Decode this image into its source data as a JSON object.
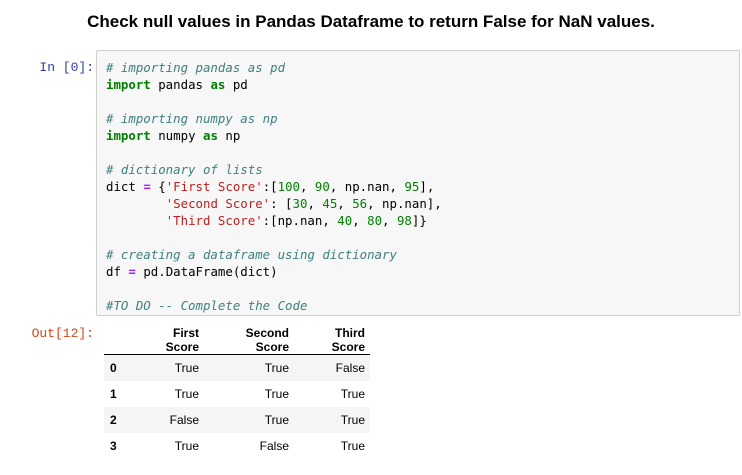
{
  "title": "Check null values in Pandas Dataframe to return False for NaN values.",
  "input_prompt": "In [0]:",
  "output_prompt": "Out[12]:",
  "code_lines": [
    "# importing pandas as pd",
    "import pandas as pd",
    "",
    "# importing numpy as np",
    "import numpy as np",
    "",
    "# dictionary of lists",
    "dict = {'First Score':[100, 90, np.nan, 95],",
    "        'Second Score': [30, 45, 56, np.nan],",
    "        'Third Score':[np.nan, 40, 80, 98]}",
    "",
    "# creating a dataframe using dictionary",
    "df = pd.DataFrame(dict)",
    "",
    "#TO DO -- Complete the Code"
  ],
  "table": {
    "columns": [
      "",
      "First Score",
      "Second Score",
      "Third Score"
    ],
    "rows": [
      {
        "index": "0",
        "values": [
          "True",
          "True",
          "False"
        ]
      },
      {
        "index": "1",
        "values": [
          "True",
          "True",
          "True"
        ]
      },
      {
        "index": "2",
        "values": [
          "False",
          "True",
          "True"
        ]
      },
      {
        "index": "3",
        "values": [
          "True",
          "False",
          "True"
        ]
      }
    ]
  }
}
